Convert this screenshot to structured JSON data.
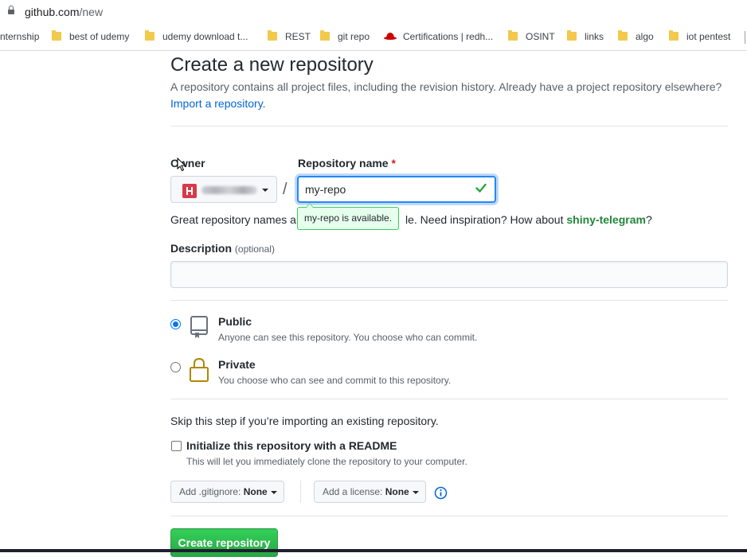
{
  "browser": {
    "url_host": "github.com",
    "url_path": "/new",
    "bookmarks": [
      {
        "label": "nternship",
        "icon": "none"
      },
      {
        "label": "best of udemy",
        "icon": "folder-icon"
      },
      {
        "label": "udemy download t...",
        "icon": "folder-icon"
      },
      {
        "label": "REST",
        "icon": "folder-icon"
      },
      {
        "label": "git repo",
        "icon": "folder-icon"
      },
      {
        "label": "Certifications | redh...",
        "icon": "redhat-icon"
      },
      {
        "label": "OSINT",
        "icon": "folder-icon"
      },
      {
        "label": "links",
        "icon": "folder-icon"
      },
      {
        "label": "algo",
        "icon": "folder-icon"
      },
      {
        "label": "iot pentest",
        "icon": "folder-icon"
      }
    ]
  },
  "page": {
    "title": "Create a new repository",
    "subtitle": "A repository contains all project files, including the revision history. Already have a project repository elsewhere?",
    "import_link": "Import a repository."
  },
  "form": {
    "owner_label": "Owner",
    "repo_label": "Repository name",
    "required_mark": "*",
    "slash": "/",
    "repo_value": "my-repo",
    "availability": "my-repo is available.",
    "hint_left": "Great repository names ar",
    "hint_right": "le. Need inspiration? How about",
    "suggestion": "shiny-telegram",
    "hint_end": "?",
    "description_label": "Description",
    "description_optional": "(optional)",
    "description_value": "",
    "visibility": [
      {
        "title": "Public",
        "desc": "Anyone can see this repository. You choose who can commit.",
        "selected": true
      },
      {
        "title": "Private",
        "desc": "You choose who can see and commit to this repository.",
        "selected": false
      }
    ],
    "skip_text": "Skip this step if you’re importing an existing repository.",
    "readme_label": "Initialize this repository with a README",
    "readme_desc": "This will let you immediately clone the repository to your computer.",
    "readme_checked": false,
    "gitignore_label": "Add .gitignore:",
    "gitignore_value": "None",
    "license_label": "Add a license:",
    "license_value": "None",
    "submit_label": "Create repository"
  },
  "colors": {
    "link": "#0366d6",
    "primary_button": "#28a745",
    "available_bg": "#e6ffed",
    "suggestion": "#22863a",
    "required": "#cb2431"
  }
}
